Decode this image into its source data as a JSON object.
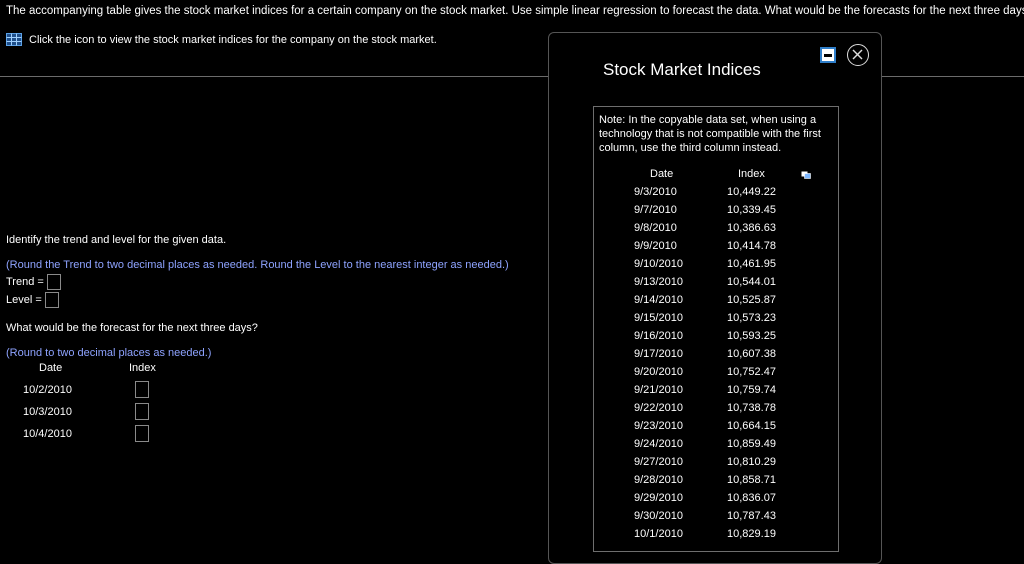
{
  "question": "The accompanying table gives the stock market indices for a certain company on the stock market. Use simple linear regression to forecast the data. What would be the forecasts for the next three days?",
  "hint": "Click the icon to view the stock market indices for the company on the stock market.",
  "identify_prompt": "Identify the trend and level for the given data.",
  "round_instruction_1": "(Round the Trend to two decimal places as needed. Round the Level to the nearest integer as needed.)",
  "trend_label": "Trend =",
  "level_label": "Level =",
  "forecast_prompt": "What would be the forecast for the next three days?",
  "round_instruction_2": "(Round to two decimal places as needed.)",
  "answer_table": {
    "headers": [
      "Date",
      "Index"
    ],
    "dates": [
      "10/2/2010",
      "10/3/2010",
      "10/4/2010"
    ]
  },
  "modal": {
    "title": "Stock Market Indices",
    "note": "Note: In the copyable data set, when using a technology that is not compatible with the first column, use the third column instead.",
    "headers": [
      "Date",
      "Index"
    ],
    "rows": [
      [
        "9/3/2010",
        "10,449.22"
      ],
      [
        "9/7/2010",
        "10,339.45"
      ],
      [
        "9/8/2010",
        "10,386.63"
      ],
      [
        "9/9/2010",
        "10,414.78"
      ],
      [
        "9/10/2010",
        "10,461.95"
      ],
      [
        "9/13/2010",
        "10,544.01"
      ],
      [
        "9/14/2010",
        "10,525.87"
      ],
      [
        "9/15/2010",
        "10,573.23"
      ],
      [
        "9/16/2010",
        "10,593.25"
      ],
      [
        "9/17/2010",
        "10,607.38"
      ],
      [
        "9/20/2010",
        "10,752.47"
      ],
      [
        "9/21/2010",
        "10,759.74"
      ],
      [
        "9/22/2010",
        "10,738.78"
      ],
      [
        "9/23/2010",
        "10,664.15"
      ],
      [
        "9/24/2010",
        "10,859.49"
      ],
      [
        "9/27/2010",
        "10,810.29"
      ],
      [
        "9/28/2010",
        "10,858.71"
      ],
      [
        "9/29/2010",
        "10,836.07"
      ],
      [
        "9/30/2010",
        "10,787.43"
      ],
      [
        "10/1/2010",
        "10,829.19"
      ]
    ]
  },
  "colors": {
    "instruction": "#8ea3ff",
    "accent_icon": "#2f7ec9"
  }
}
